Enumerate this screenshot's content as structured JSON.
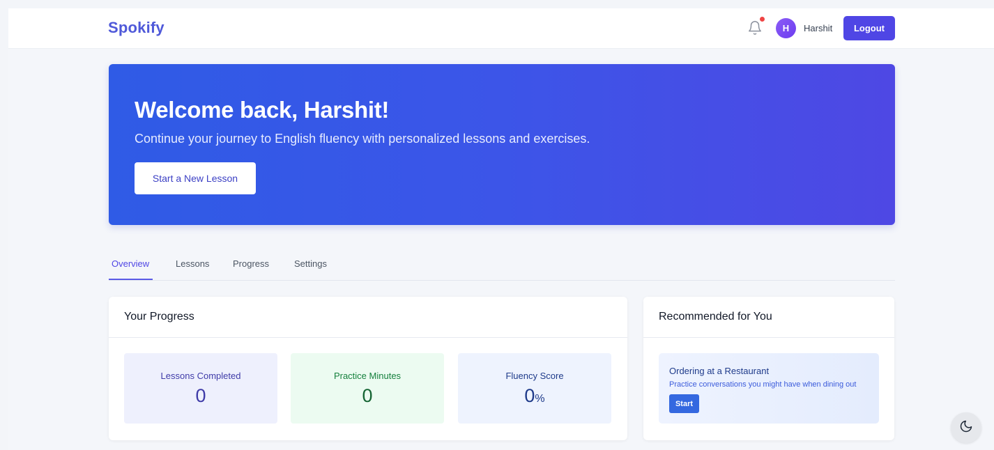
{
  "header": {
    "brand": "Spokify",
    "avatar_initial": "H",
    "username": "Harshit",
    "logout_label": "Logout"
  },
  "hero": {
    "title": "Welcome back, Harshit!",
    "subtitle": "Continue your journey to English fluency with personalized lessons and exercises.",
    "cta_label": "Start a New Lesson"
  },
  "tabs": [
    {
      "label": "Overview",
      "active": true
    },
    {
      "label": "Lessons",
      "active": false
    },
    {
      "label": "Progress",
      "active": false
    },
    {
      "label": "Settings",
      "active": false
    }
  ],
  "progress": {
    "title": "Your Progress",
    "stats": [
      {
        "label": "Lessons Completed",
        "value": "0",
        "unit": ""
      },
      {
        "label": "Practice Minutes",
        "value": "0",
        "unit": ""
      },
      {
        "label": "Fluency Score",
        "value": "0",
        "unit": "%"
      }
    ]
  },
  "recommended": {
    "title": "Recommended for You",
    "item": {
      "title": "Ordering at a Restaurant",
      "description": "Practice conversations you might have when dining out",
      "button_label": "Start"
    }
  },
  "icons": {
    "notifications": "bell-icon",
    "theme_toggle": "moon-icon"
  },
  "colors": {
    "brand": "#4f59d9",
    "primary": "#4f46e5",
    "notification_dot": "#ef4444",
    "stat_lessons_bg": "#eef0fd",
    "stat_lessons_text": "#3f3ba8",
    "stat_minutes_bg": "#ecfbf1",
    "stat_minutes_text": "#15803d",
    "stat_fluency_bg": "#eef3fe",
    "stat_fluency_text": "#1e3a8a"
  }
}
